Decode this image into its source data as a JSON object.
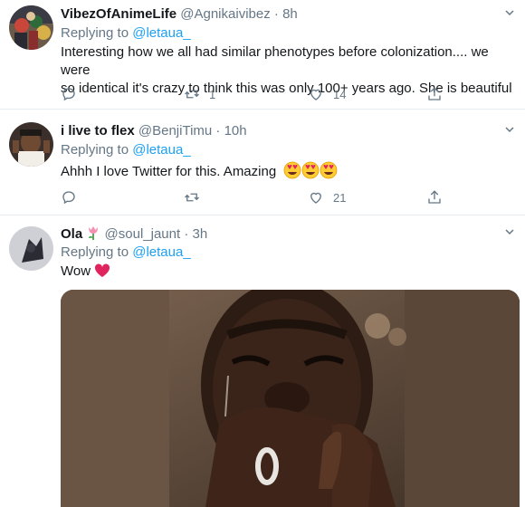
{
  "replying_prefix": "Replying to ",
  "tweets": [
    {
      "name": "VibezOfAnimeLife",
      "handle": "@Agnikaivibez",
      "separator": "·",
      "time": "8h",
      "reply_to": "@letaua_",
      "text_line1": "Interesting how we all had similar phenotypes before colonization.... we were",
      "text_line2": "so identical it's crazy to think this was only 100+ years ago. She is beautiful",
      "replies": "",
      "retweets": "1",
      "likes": "14"
    },
    {
      "name": "i live to flex",
      "handle": "@BenjiTimu",
      "separator": "·",
      "time": "10h",
      "reply_to": "@letaua_",
      "text": "Ahhh I love Twitter for this. Amazing",
      "emojis": "heart-eyes x3",
      "replies": "",
      "retweets": "",
      "likes": "21"
    },
    {
      "name": "Ola",
      "name_emoji": "tulip",
      "handle": "@soul_jaunt",
      "separator": "·",
      "time": "3h",
      "reply_to": "@letaua_",
      "text": "Wow",
      "emoji": "red-heart",
      "media": "video still of crying man covering mouth"
    }
  ],
  "colors": {
    "accent": "#1da1f2",
    "secondary_text": "#657786",
    "heart": "#e0245e",
    "divider": "#e6ecf0"
  }
}
